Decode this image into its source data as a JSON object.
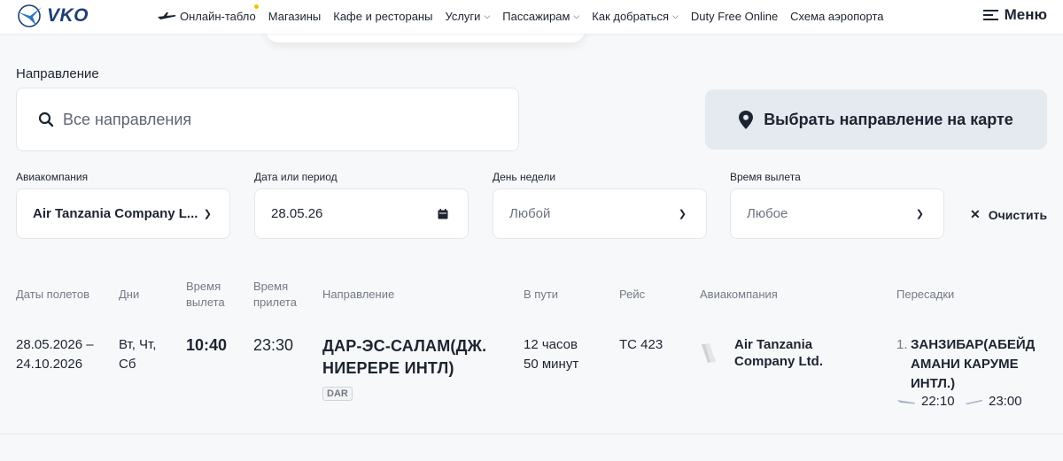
{
  "header": {
    "logo_text": "VKO",
    "nav": [
      {
        "label": "Онлайн-табло"
      },
      {
        "label": "Магазины"
      },
      {
        "label": "Кафе и рестораны"
      },
      {
        "label": "Услуги"
      },
      {
        "label": "Пассажирам"
      },
      {
        "label": "Как добраться"
      },
      {
        "label": "Duty Free Online"
      },
      {
        "label": "Схема аэропорта"
      }
    ],
    "menu_label": "Меню"
  },
  "filters": {
    "direction_label": "Направление",
    "direction_placeholder": "Все направления",
    "map_button": "Выбрать направление на карте",
    "airline_label": "Авиакомпания",
    "airline_value": "Air Tanzania Company L...",
    "date_label": "Дата или период",
    "date_value": "28.05.26",
    "weekday_label": "День недели",
    "weekday_value": "Любой",
    "time_label": "Время вылета",
    "time_value": "Любое",
    "clear_label": "Очистить"
  },
  "table": {
    "headers": {
      "dates": "Даты полетов",
      "days": "Дни",
      "dep_line1": "Время",
      "dep_line2": "вылета",
      "arr_line1": "Время",
      "arr_line2": "прилета",
      "direction": "Направление",
      "duration": "В пути",
      "flight": "Рейс",
      "airline": "Авиакомпания",
      "transfers": "Пересадки"
    },
    "rows": [
      {
        "dates_line1": "28.05.2026 –",
        "dates_line2": "24.10.2026",
        "days_line1": "Вт, Чт,",
        "days_line2": "Сб",
        "departure": "10:40",
        "arrival": "23:30",
        "direction_line1": "ДАР-ЭС-САЛАМ(ДЖ.",
        "direction_line2": "НИЕРЕРЕ ИНТЛ)",
        "direction_code": "DAR",
        "duration_line1": "12 часов",
        "duration_line2": "50 минут",
        "flight": "TC 423",
        "airline_line1": "Air Tanzania",
        "airline_line2": "Company Ltd.",
        "transfer_num": "1.",
        "transfer_line1": "ЗАНЗИБАР(АБЕЙД",
        "transfer_line2": "АМАНИ КАРУМЕ",
        "transfer_line3": "ИНТЛ.)",
        "transfer_arrival": "22:10",
        "transfer_departure": "23:00"
      }
    ]
  },
  "colors": {
    "brand": "#1e3e74",
    "map_button_bg": "#e5e9f0",
    "muted_text": "#737a85",
    "notification_dot": "#f2c200"
  }
}
